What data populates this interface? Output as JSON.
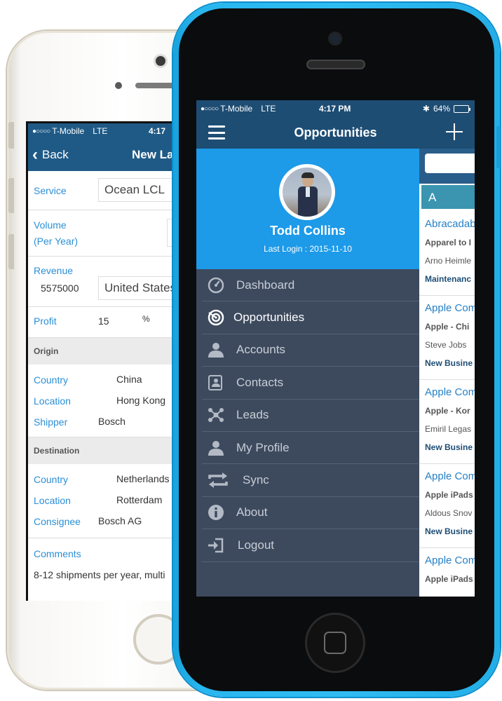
{
  "back_phone": {
    "status": {
      "signal": "●○○○○",
      "carrier": "T-Mobile",
      "network": "LTE",
      "time": "4:17"
    },
    "nav": {
      "back_label": "Back",
      "title": "New La"
    },
    "form": {
      "service": {
        "label": "Service",
        "value": "Ocean LCL"
      },
      "volume": {
        "label": "Volume",
        "sub": "(Per Year)"
      },
      "revenue": {
        "label": "Revenue",
        "amount": "5575000",
        "currency": "United States"
      },
      "profit": {
        "label": "Profit",
        "value": "15",
        "unit": "%"
      },
      "origin": {
        "header": "Origin",
        "rows": [
          {
            "label": "Country",
            "value": "China"
          },
          {
            "label": "Location",
            "value": "Hong Kong"
          },
          {
            "label": "Shipper",
            "value": "Bosch"
          }
        ]
      },
      "destination": {
        "header": "Destination",
        "rows": [
          {
            "label": "Country",
            "value": "Netherlands"
          },
          {
            "label": "Location",
            "value": "Rotterdam"
          },
          {
            "label": "Consignee",
            "value": "Bosch AG"
          }
        ]
      },
      "comments": {
        "label": "Comments",
        "value": "8-12 shipments per year, multi"
      }
    }
  },
  "front_phone": {
    "status": {
      "signal": "●○○○○",
      "carrier": "T-Mobile",
      "network": "LTE",
      "time": "4:17 PM",
      "bluetooth": "✱",
      "battery": "64%"
    },
    "nav": {
      "title": "Opportunities"
    },
    "profile": {
      "name": "Todd Collins",
      "last_login": "Last Login : 2015-11-10"
    },
    "menu": [
      {
        "label": "Dashboard",
        "icon": "gauge-icon"
      },
      {
        "label": "Opportunities",
        "icon": "target-icon"
      },
      {
        "label": "Accounts",
        "icon": "person-icon"
      },
      {
        "label": "Contacts",
        "icon": "contact-card-icon"
      },
      {
        "label": "Leads",
        "icon": "network-icon"
      },
      {
        "label": "My Profile",
        "icon": "person-icon"
      },
      {
        "label": "Sync",
        "icon": "sync-icon"
      },
      {
        "label": "About",
        "icon": "info-icon"
      },
      {
        "label": "Logout",
        "icon": "logout-icon"
      }
    ],
    "list": {
      "section_letter": "A",
      "items": [
        {
          "name": "Abracadab",
          "company": "Apparel to I",
          "person": "Arno Heimle",
          "stage": "Maintenanc"
        },
        {
          "name": "Apple Com",
          "company": "Apple - Chi",
          "person": "Steve Jobs",
          "stage": "New Busine"
        },
        {
          "name": "Apple Com",
          "company": "Apple - Kor",
          "person": "Emiril Legas",
          "stage": "New Busine"
        },
        {
          "name": "Apple Com",
          "company": "Apple iPads",
          "person": "Aldous Snov",
          "stage": "New Busine"
        },
        {
          "name": "Apple Com",
          "company": "Apple iPads",
          "person": "",
          "stage": ""
        }
      ]
    }
  },
  "colors": {
    "nav_blue": "#1e4d74",
    "profile_blue": "#1d9ae8",
    "drawer": "#3d4a5e",
    "link_blue": "#2b8fd6",
    "phone_blue": "#2fbcf2"
  }
}
